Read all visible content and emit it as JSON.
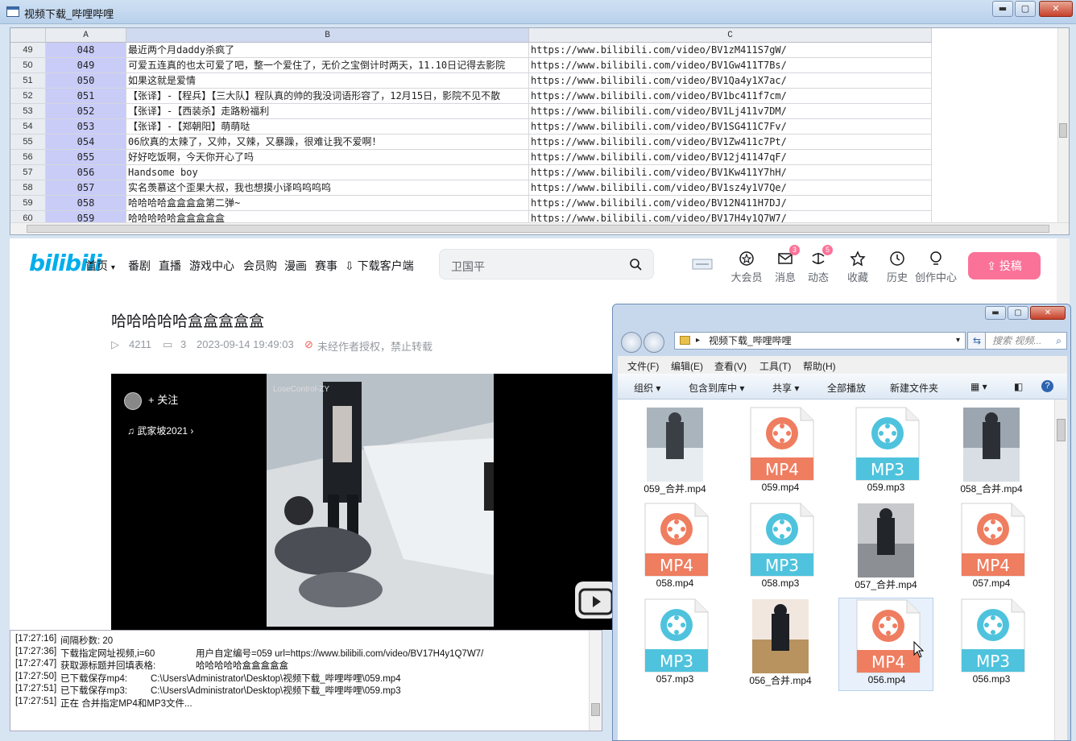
{
  "window": {
    "title": "视频下载_哔哩哔哩",
    "min": "▬",
    "max": "▢",
    "close": "✕"
  },
  "sheet": {
    "columns": [
      "A",
      "B",
      "C"
    ],
    "rows": [
      {
        "n": "49",
        "a": "048",
        "b": "最近两个月daddy杀疯了",
        "c": "https://www.bilibili.com/video/BV1zM411S7gW/"
      },
      {
        "n": "50",
        "a": "049",
        "b": "可爱五连真的也太可爱了吧，整一个爱住了，无价之宝倒计时两天，11.10日记得去影院",
        "c": "https://www.bilibili.com/video/BV1Gw411T7Bs/"
      },
      {
        "n": "51",
        "a": "050",
        "b": "如果这就是爱情",
        "c": "https://www.bilibili.com/video/BV1Qa4y1X7ac/"
      },
      {
        "n": "52",
        "a": "051",
        "b": "【张译】-【程兵】【三大队】程队真的帅的我没词语形容了，12月15日，影院不见不散",
        "c": "https://www.bilibili.com/video/BV1bc411f7cm/"
      },
      {
        "n": "53",
        "a": "052",
        "b": "【张译】-【西装杀】走路粉福利",
        "c": "https://www.bilibili.com/video/BV1Lj411v7DM/"
      },
      {
        "n": "54",
        "a": "053",
        "b": "【张译】-【郑朝阳】萌萌哒",
        "c": "https://www.bilibili.com/video/BV1SG411C7Fv/"
      },
      {
        "n": "55",
        "a": "054",
        "b": "06欣真的太辣了，又帅，又辣，又暴躁，很难让我不爱啊！",
        "c": "https://www.bilibili.com/video/BV1Zw411c7Pt/"
      },
      {
        "n": "56",
        "a": "055",
        "b": "好好吃饭啊，今天你开心了吗",
        "c": "https://www.bilibili.com/video/BV12j41147qF/"
      },
      {
        "n": "57",
        "a": "056",
        "b": "Handsome boy",
        "c": "https://www.bilibili.com/video/BV1Kw411Y7hH/"
      },
      {
        "n": "58",
        "a": "057",
        "b": "实名羡慕这个歪果大叔，我也想摸小译呜呜呜呜",
        "c": "https://www.bilibili.com/video/BV1sz4y1V7Qe/"
      },
      {
        "n": "59",
        "a": "058",
        "b": "哈哈哈哈盒盒盒盒第二弹~",
        "c": "https://www.bilibili.com/video/BV12N411H7DJ/"
      },
      {
        "n": "60",
        "a": "059",
        "b": "哈哈哈哈哈盒盒盒盒盒",
        "c": "https://www.bilibili.com/video/BV17H4y1Q7W7/"
      }
    ]
  },
  "bili": {
    "logo": "bilibili",
    "nav": [
      "首页",
      "番剧",
      "直播",
      "游戏中心",
      "会员购",
      "漫画",
      "赛事",
      "下载客户端"
    ],
    "search_placeholder": "卫国平",
    "icons": [
      {
        "label": "大会员",
        "badge": ""
      },
      {
        "label": "消息",
        "badge": "3"
      },
      {
        "label": "动态",
        "badge": "5"
      },
      {
        "label": "收藏",
        "badge": ""
      },
      {
        "label": "历史",
        "badge": ""
      },
      {
        "label": "创作中心",
        "badge": ""
      }
    ],
    "upload": "投稿",
    "video_title": "哈哈哈哈哈盒盒盒盒盒",
    "views": "4211",
    "comments": "3",
    "date": "2023-09-14 19:49:03",
    "copyright": "未经作者授权，禁止转载",
    "player": {
      "follow": "+ 关注",
      "music": "武家坡2021",
      "watermark": "LoseControl-ZY"
    }
  },
  "log": [
    {
      "time": "[17:27:16]",
      "msg": "间隔秒数: 20",
      "extra": ""
    },
    {
      "time": "[17:27:36]",
      "msg": "下载指定网址视频,i=60",
      "extra": "用户自定编号=059    url=https://www.bilibili.com/video/BV17H4y1Q7W7/"
    },
    {
      "time": "[17:27:47]",
      "msg": "获取源标题并回填表格:",
      "extra": "哈哈哈哈哈盒盒盒盒盒"
    },
    {
      "time": "[17:27:50]",
      "msg": "已下载保存mp4:",
      "extra": "C:\\Users\\Administrator\\Desktop\\视频下载_哔哩哔哩\\059.mp4"
    },
    {
      "time": "[17:27:51]",
      "msg": "已下载保存mp3:",
      "extra": "C:\\Users\\Administrator\\Desktop\\视频下载_哔哩哔哩\\059.mp3"
    },
    {
      "time": "[17:27:51]",
      "msg": "正在 合并指定MP4和MP3文件...",
      "extra": ""
    }
  ],
  "explorer": {
    "path": "视频下载_哔哩哔哩",
    "search_placeholder": "搜索 视频...",
    "menu": [
      "文件(F)",
      "编辑(E)",
      "查看(V)",
      "工具(T)",
      "帮助(H)"
    ],
    "toolbar": [
      "组织 ▾",
      "包含到库中 ▾",
      "共享 ▾",
      "全部播放",
      "新建文件夹"
    ],
    "files": [
      {
        "name": "059_合并.mp4",
        "kind": "thumb"
      },
      {
        "name": "059.mp4",
        "kind": "MP4"
      },
      {
        "name": "059.mp3",
        "kind": "MP3"
      },
      {
        "name": "058_合并.mp4",
        "kind": "thumb"
      },
      {
        "name": "058.mp4",
        "kind": "MP4"
      },
      {
        "name": "058.mp3",
        "kind": "MP3"
      },
      {
        "name": "057_合并.mp4",
        "kind": "thumb"
      },
      {
        "name": "057.mp4",
        "kind": "MP4"
      },
      {
        "name": "057.mp3",
        "kind": "MP3"
      },
      {
        "name": "056_合并.mp4",
        "kind": "thumb"
      },
      {
        "name": "056.mp4",
        "kind": "MP4"
      },
      {
        "name": "056.mp3",
        "kind": "MP3"
      }
    ]
  },
  "colors": {
    "mp4": "#ef7d60",
    "mp3": "#4fc3dd",
    "bili_blue": "#00aeec",
    "bili_pink": "#fb7299"
  }
}
